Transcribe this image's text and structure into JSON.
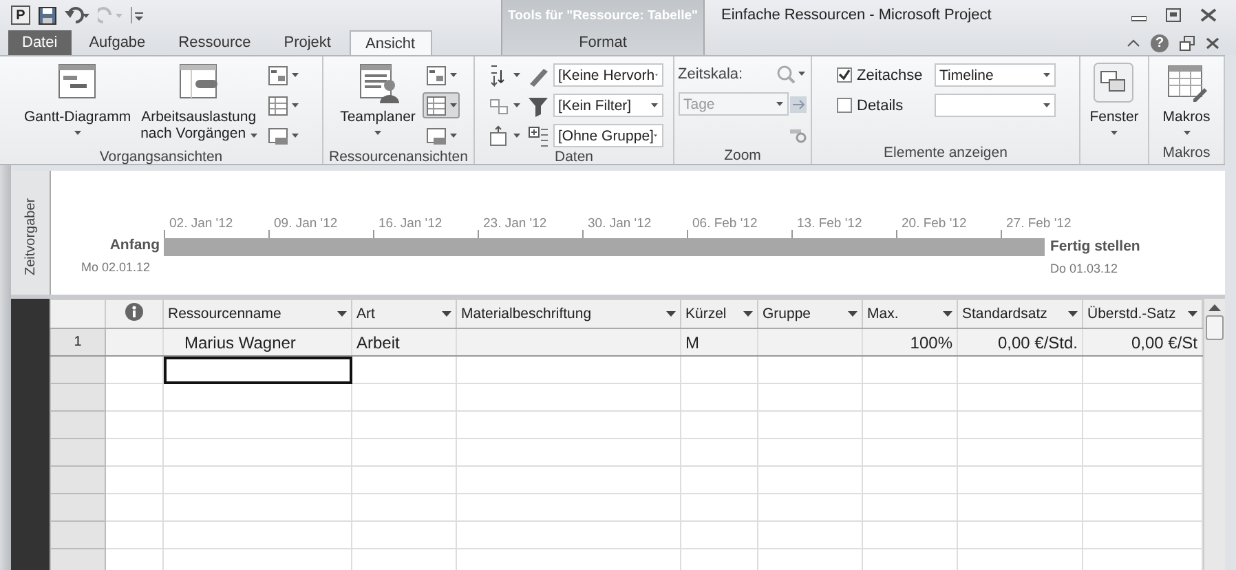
{
  "window": {
    "app_letter": "P",
    "title": "Einfache Ressourcen - Microsoft Project",
    "context_title": "Tools für \"Ressource: Tabelle\"",
    "help": "?"
  },
  "tabs": [
    {
      "label": "Datei",
      "kind": "file",
      "selected": false
    },
    {
      "label": "Aufgabe",
      "kind": "normal",
      "selected": false
    },
    {
      "label": "Ressource",
      "kind": "normal",
      "selected": false
    },
    {
      "label": "Projekt",
      "kind": "normal",
      "selected": false
    },
    {
      "label": "Ansicht",
      "kind": "normal",
      "selected": true
    },
    {
      "label": "Format",
      "kind": "contextual",
      "selected": false
    }
  ],
  "ribbon": {
    "groups": [
      {
        "label": "Vorgangsansichten",
        "controls": [
          {
            "kind": "big",
            "lines": [
              "Gantt-Diagramm"
            ],
            "menu": true
          },
          {
            "kind": "big",
            "lines": [
              "Arbeitsauslastung",
              "nach Vorgängen"
            ],
            "menu": true
          },
          {
            "kind": "icon_stack",
            "items": [
              {
                "pressed": false
              },
              {
                "pressed": false
              },
              {
                "pressed": false
              }
            ]
          }
        ]
      },
      {
        "label": "Ressourcenansichten",
        "controls": [
          {
            "kind": "big",
            "lines": [
              "Teamplaner"
            ],
            "menu": true
          },
          {
            "kind": "icon_stack",
            "items": [
              {
                "pressed": false
              },
              {
                "pressed": true
              },
              {
                "pressed": false
              }
            ]
          }
        ]
      },
      {
        "label": "Daten",
        "controls": [
          {
            "kind": "select_stack",
            "values": [
              "[Keine Hervorh",
              "[Kein Filter]",
              "[Ohne Gruppe]"
            ]
          }
        ]
      },
      {
        "label": "Zoom",
        "controls": [
          {
            "kind": "zoom",
            "caption": "Zeitskala:",
            "value": "Tage",
            "disabled": true
          }
        ]
      },
      {
        "label": "Elemente anzeigen",
        "controls": [
          {
            "kind": "check_stack",
            "items": [
              {
                "label": "Zeitachse",
                "checked": true,
                "value": "Timeline"
              },
              {
                "label": "Details",
                "checked": false
              }
            ]
          }
        ]
      },
      {
        "controls": [
          {
            "kind": "big",
            "lines": [
              "Fenster"
            ],
            "menu": true
          }
        ]
      },
      {
        "label": "Makros",
        "controls": [
          {
            "kind": "big",
            "lines": [
              "Makros"
            ],
            "menu": true
          }
        ]
      }
    ]
  },
  "timeline": {
    "side_label": "Zeitvorgaber",
    "start_label": "Anfang",
    "start_date": "Mo 02.01.12",
    "ticks": [
      "02. Jan '12",
      "09. Jan '12",
      "16. Jan '12",
      "23. Jan '12",
      "30. Jan '12",
      "06. Feb '12",
      "13. Feb '12",
      "20. Feb '12",
      "27. Feb '12"
    ],
    "end_label": "Fertig stellen",
    "end_date": "Do 01.03.12"
  },
  "table": {
    "columns": [
      {
        "kind": "info"
      },
      {
        "kind": "text",
        "label": "Ressourcenname"
      },
      {
        "kind": "text",
        "label": "Art"
      },
      {
        "kind": "text",
        "label": "Materialbeschriftung"
      },
      {
        "kind": "text",
        "label": "Kürzel"
      },
      {
        "kind": "text",
        "label": "Gruppe"
      },
      {
        "kind": "number",
        "label": "Max."
      },
      {
        "kind": "number",
        "label": "Standardsatz"
      },
      {
        "kind": "number",
        "label": "Überstd.-Satz"
      }
    ],
    "rows": [
      {
        "number": "1",
        "selected": false,
        "cells": [
          null,
          "Marius Wagner",
          "Arbeit",
          null,
          "M",
          null,
          "100%",
          "0,00 €/Std.",
          "0,00 €/St"
        ]
      },
      {
        "selected": true
      }
    ]
  }
}
